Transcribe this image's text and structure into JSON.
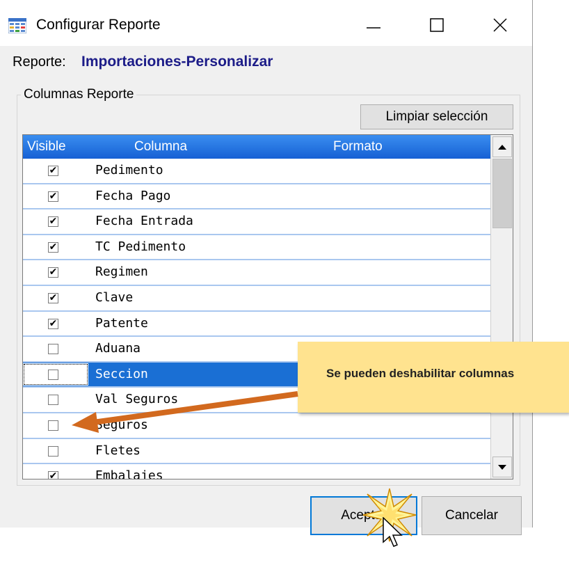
{
  "window": {
    "title": "Configurar Reporte",
    "minimize_icon": "minimize-icon",
    "maximize_icon": "maximize-icon",
    "close_icon": "close-icon"
  },
  "report": {
    "label": "Reporte:",
    "name": "Importaciones-Personalizar"
  },
  "group": {
    "label": "Columnas Reporte",
    "clear_button": "Limpiar selección"
  },
  "grid": {
    "headers": {
      "visible": "Visible",
      "column": "Columna",
      "format": "Formato"
    },
    "rows": [
      {
        "checked": true,
        "name": "Pedimento"
      },
      {
        "checked": true,
        "name": "Fecha Pago"
      },
      {
        "checked": true,
        "name": "Fecha Entrada"
      },
      {
        "checked": true,
        "name": "TC Pedimento"
      },
      {
        "checked": true,
        "name": "Regimen"
      },
      {
        "checked": true,
        "name": "Clave"
      },
      {
        "checked": true,
        "name": "Patente"
      },
      {
        "checked": false,
        "name": "Aduana"
      },
      {
        "checked": false,
        "name": "Seccion",
        "selected": true
      },
      {
        "checked": false,
        "name": "Val Seguros"
      },
      {
        "checked": false,
        "name": "Seguros"
      },
      {
        "checked": false,
        "name": "Fletes"
      },
      {
        "checked": true,
        "name": "Embalajes"
      }
    ]
  },
  "buttons": {
    "accept": "Aceptar",
    "cancel": "Cancelar"
  },
  "callout": {
    "text": "Se pueden deshabilitar columnas"
  },
  "colors": {
    "header_blue": "#1660d4",
    "selection_blue": "#1a6fd4",
    "report_name": "#1c1c88",
    "callout_bg": "#ffe38f",
    "arrow": "#d2691e"
  }
}
